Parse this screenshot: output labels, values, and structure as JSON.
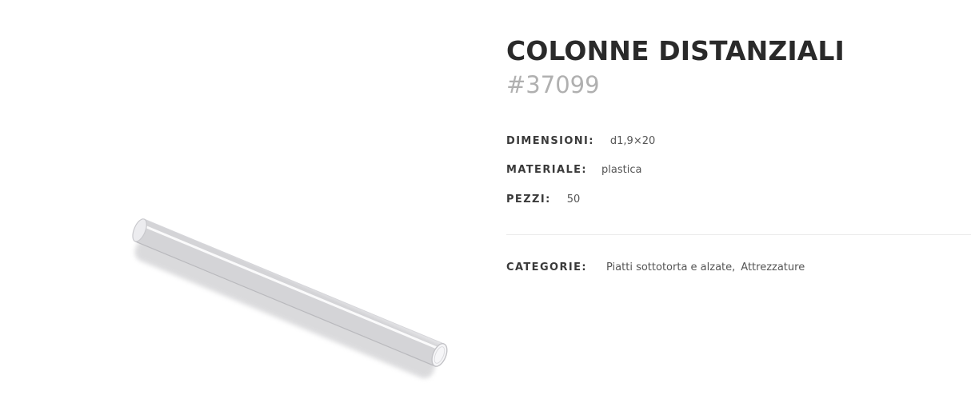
{
  "product": {
    "title": "COLONNE DISTANZIALI",
    "code": "#37099",
    "attributes": [
      {
        "label": "DIMENSIONI:",
        "value": "d1,9×20"
      },
      {
        "label": "MATERIALE:",
        "value": "plastica"
      },
      {
        "label": "PEZZI:",
        "value": "50"
      }
    ],
    "categories": {
      "label": "CATEGORIE:",
      "items": [
        "Piatti sottotorta e alzate",
        "Attrezzature"
      ],
      "separator": ","
    }
  },
  "image": {
    "subject": "white-plastic-tube-icon",
    "colors": {
      "tube_light": "#f7f7f8",
      "tube_mid": "#e6e6e8",
      "tube_shadow": "#c9c9cc"
    }
  }
}
